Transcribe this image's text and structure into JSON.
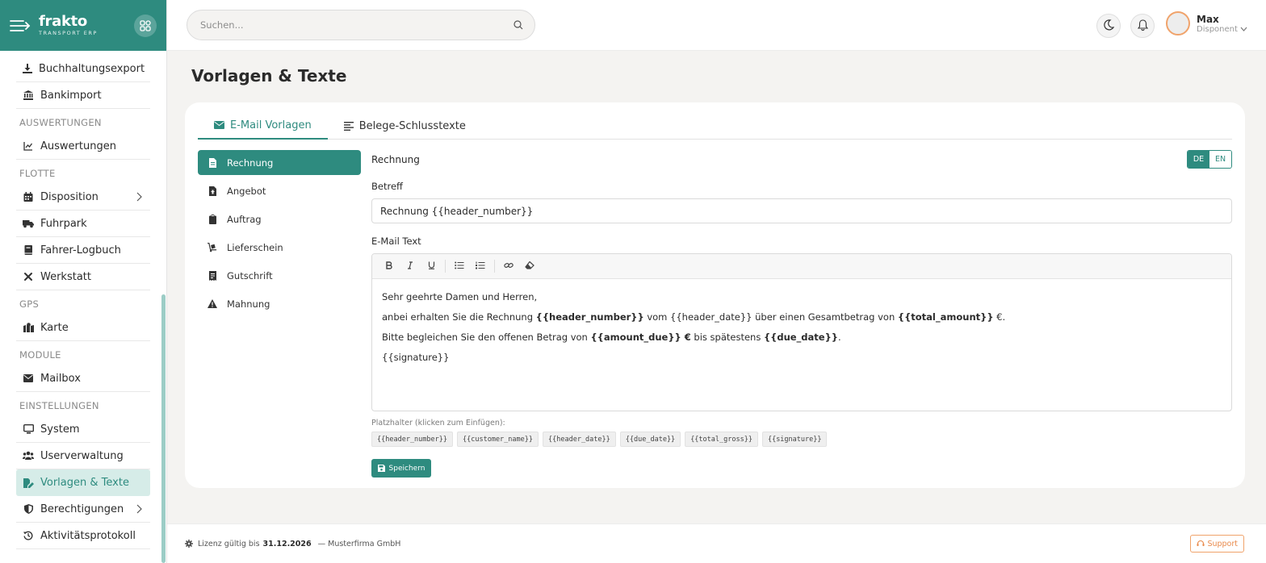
{
  "app": {
    "brand_name": "frakto",
    "brand_sub": "TRANSPORT ERP"
  },
  "sidebar": {
    "items_top": [
      {
        "label": "Buchhaltungsexport",
        "icon": "download-icon"
      },
      {
        "label": "Bankimport",
        "icon": "bank-icon"
      }
    ],
    "sections": [
      {
        "title": "AUSWERTUNGEN",
        "items": [
          {
            "label": "Auswertungen",
            "icon": "chart-line-icon"
          }
        ]
      },
      {
        "title": "FLOTTE",
        "items": [
          {
            "label": "Disposition",
            "icon": "calendar-icon",
            "has_children": true
          },
          {
            "label": "Fuhrpark",
            "icon": "truck-icon"
          },
          {
            "label": "Fahrer-Logbuch",
            "icon": "book-icon"
          },
          {
            "label": "Werkstatt",
            "icon": "tools-icon"
          }
        ]
      },
      {
        "title": "GPS",
        "items": [
          {
            "label": "Karte",
            "icon": "map-icon"
          }
        ]
      },
      {
        "title": "MODULE",
        "items": [
          {
            "label": "Mailbox",
            "icon": "envelope-icon"
          }
        ]
      },
      {
        "title": "EINSTELLUNGEN",
        "items": [
          {
            "label": "System",
            "icon": "monitor-icon"
          },
          {
            "label": "Userverwaltung",
            "icon": "users-icon"
          },
          {
            "label": "Vorlagen & Texte",
            "icon": "file-edit-icon",
            "active": true
          },
          {
            "label": "Berechtigungen",
            "icon": "shield-icon",
            "has_children": true
          },
          {
            "label": "Aktivitätsprotokoll",
            "icon": "history-icon"
          }
        ]
      }
    ]
  },
  "topbar": {
    "search_placeholder": "Suchen...",
    "user_name": "Max",
    "user_role": "Disponent"
  },
  "page": {
    "title": "Vorlagen & Texte",
    "tabs": [
      {
        "label": "E-Mail Vorlagen",
        "icon": "envelope-icon",
        "active": true
      },
      {
        "label": "Belege-Schlusstexte",
        "icon": "align-left-icon",
        "active": false
      }
    ],
    "documents": [
      {
        "label": "Rechnung",
        "icon": "file-icon",
        "active": true
      },
      {
        "label": "Angebot",
        "icon": "file-dollar-icon"
      },
      {
        "label": "Auftrag",
        "icon": "clipboard-icon"
      },
      {
        "label": "Lieferschein",
        "icon": "dolly-icon"
      },
      {
        "label": "Gutschrift",
        "icon": "receipt-icon"
      },
      {
        "label": "Mahnung",
        "icon": "warning-icon"
      }
    ],
    "form": {
      "section_label": "Rechnung",
      "lang_de": "DE",
      "lang_en": "EN",
      "subject_label": "Betreff",
      "subject_value": "Rechnung {{header_number}}",
      "body_label": "E-Mail Text",
      "body": {
        "line1": "Sehr geehrte Damen und Herren,",
        "line2_a": "anbei erhalten Sie die Rechnung ",
        "line2_b": "{{header_number}}",
        "line2_c": " vom {{header_date}} über einen Gesamtbetrag von ",
        "line2_d": "{{total_amount}}",
        "line2_e": " €.",
        "line3_a": "Bitte begleichen Sie den offenen Betrag von ",
        "line3_b": "{{amount_due}} €",
        "line3_c": " bis spätestens ",
        "line3_d": "{{due_date}}",
        "line3_e": ".",
        "line4": "{{signature}}"
      },
      "placeholders_label": "Platzhalter (klicken zum Einfügen):",
      "placeholders": [
        "{{header_number}}",
        "{{customer_name}}",
        "{{header_date}}",
        "{{due_date}}",
        "{{total_gross}}",
        "{{signature}}"
      ],
      "save_label": "Speichern"
    }
  },
  "footer": {
    "license_prefix": "Lizenz gültig bis",
    "license_date": "31.12.2026",
    "company": "— Musterfirma GmbH",
    "support_label": "Support"
  },
  "colors": {
    "accent": "#2e8b7f",
    "accent_light": "#d6ece8",
    "support": "#e98a4b"
  }
}
